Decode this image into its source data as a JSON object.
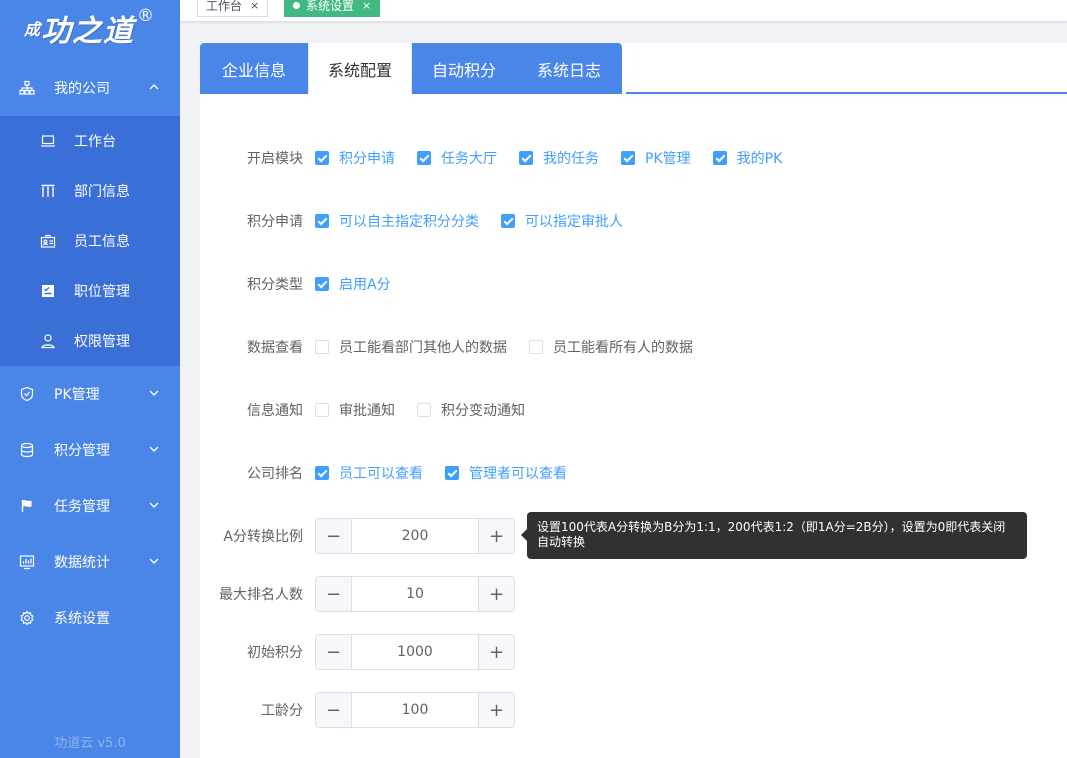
{
  "sidebar": {
    "logo": {
      "prefix": "成",
      "main": "功之道",
      "reg": "®"
    },
    "menu": [
      {
        "label": "我的公司",
        "icon": "org-icon",
        "expanded": true
      },
      {
        "label": "PK管理",
        "icon": "shield-icon"
      },
      {
        "label": "积分管理",
        "icon": "database-icon"
      },
      {
        "label": "任务管理",
        "icon": "flag-icon"
      },
      {
        "label": "数据统计",
        "icon": "chart-icon"
      },
      {
        "label": "系统设置",
        "icon": "gear-icon"
      }
    ],
    "submenu": [
      {
        "label": "工作台",
        "icon": "laptop-icon"
      },
      {
        "label": "部门信息",
        "icon": "columns-icon"
      },
      {
        "label": "员工信息",
        "icon": "id-card-icon"
      },
      {
        "label": "职位管理",
        "icon": "checklist-icon"
      },
      {
        "label": "权限管理",
        "icon": "user-icon"
      }
    ],
    "version": "功道云 v5.0"
  },
  "tags": [
    {
      "label": "工作台",
      "close": "×"
    },
    {
      "label": "系统设置",
      "close": "×",
      "active": true
    }
  ],
  "tabs": [
    "企业信息",
    "系统配置",
    "自动积分",
    "系统日志"
  ],
  "active_tab": 1,
  "form": {
    "rows": [
      {
        "label": "开启模块",
        "options": [
          {
            "label": "积分申请",
            "checked": true
          },
          {
            "label": "任务大厅",
            "checked": true
          },
          {
            "label": "我的任务",
            "checked": true
          },
          {
            "label": "PK管理",
            "checked": true
          },
          {
            "label": "我的PK",
            "checked": true
          }
        ]
      },
      {
        "label": "积分申请",
        "options": [
          {
            "label": "可以自主指定积分分类",
            "checked": true
          },
          {
            "label": "可以指定审批人",
            "checked": true
          }
        ]
      },
      {
        "label": "积分类型",
        "options": [
          {
            "label": "启用A分",
            "checked": true
          }
        ]
      },
      {
        "label": "数据查看",
        "options": [
          {
            "label": "员工能看部门其他人的数据",
            "checked": false
          },
          {
            "label": "员工能看所有人的数据",
            "checked": false
          }
        ]
      },
      {
        "label": "信息通知",
        "options": [
          {
            "label": "审批通知",
            "checked": false
          },
          {
            "label": "积分变动通知",
            "checked": false
          }
        ]
      },
      {
        "label": "公司排名",
        "options": [
          {
            "label": "员工可以查看",
            "checked": true
          },
          {
            "label": "管理者可以查看",
            "checked": true
          }
        ]
      }
    ],
    "numbers": [
      {
        "label": "A分转换比例",
        "value": "200"
      },
      {
        "label": "最大排名人数",
        "value": "10"
      },
      {
        "label": "初始积分",
        "value": "1000"
      },
      {
        "label": "工龄分",
        "value": "100"
      }
    ],
    "stepper_minus": "−",
    "stepper_plus": "+",
    "tooltip": "设置100代表A分转换为B分为1:1，200代表1:2（即1A分=2B分），设置为0即代表关闭自动转换"
  },
  "colors": {
    "sidebar": "#4a86e8",
    "submenu": "#3a6fd8",
    "primary": "#409eff",
    "tag_active": "#42b983"
  }
}
